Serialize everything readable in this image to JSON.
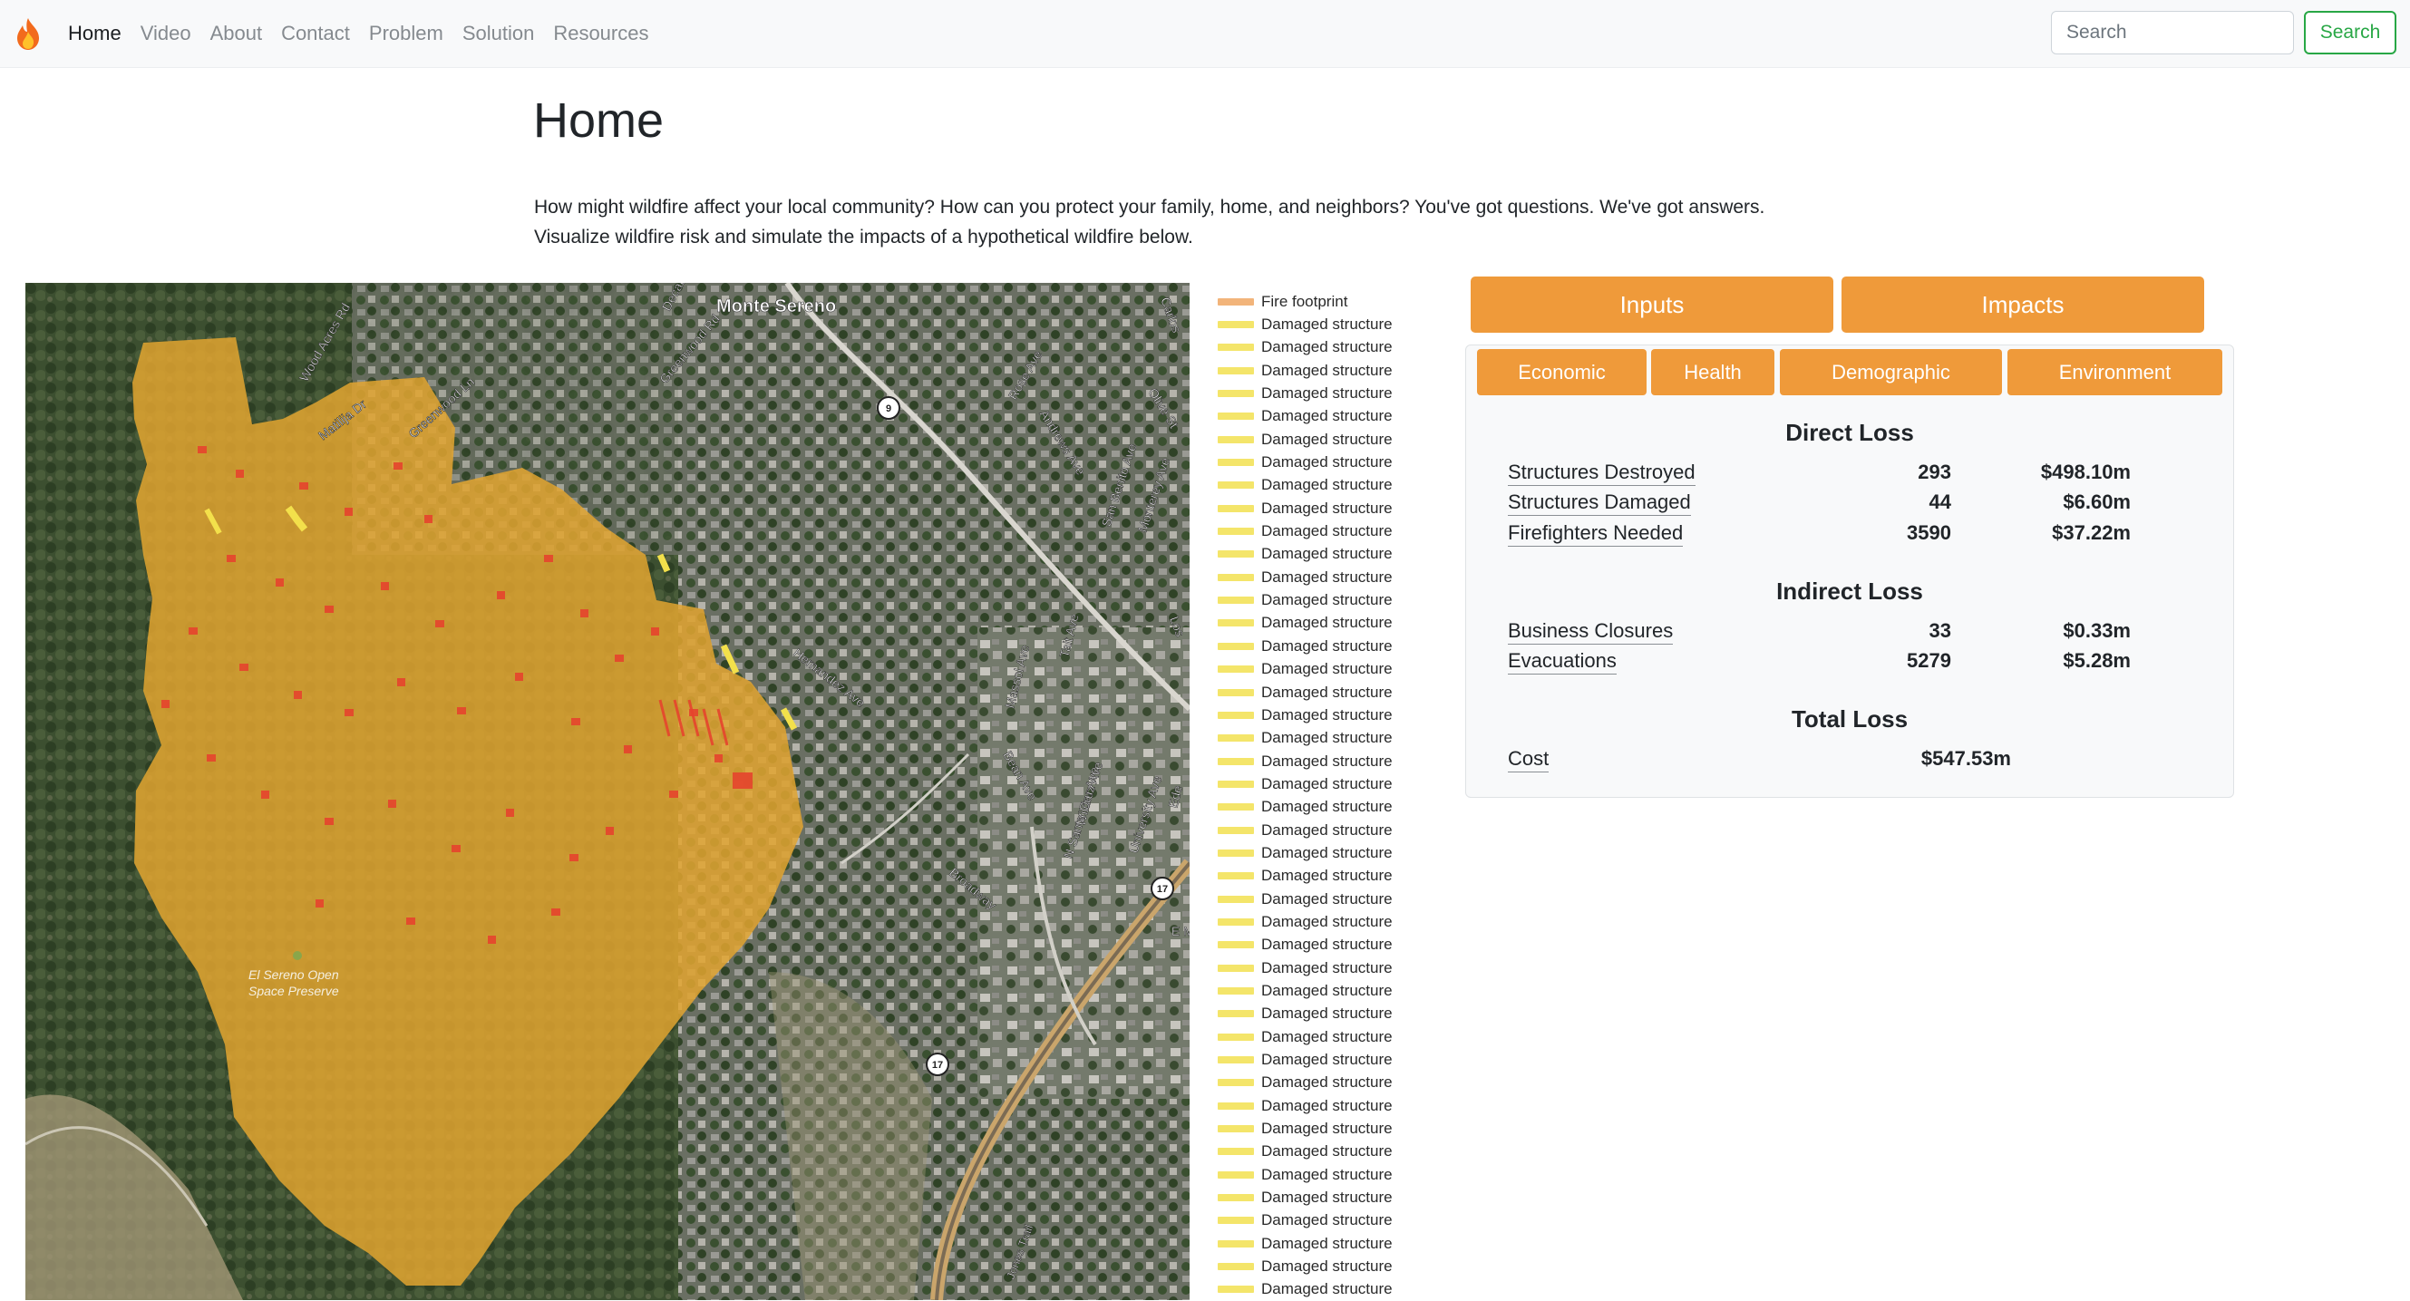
{
  "navbar": {
    "brand_icon": "fire-icon",
    "links": [
      {
        "label": "Home",
        "active": true
      },
      {
        "label": "Video"
      },
      {
        "label": "About"
      },
      {
        "label": "Contact"
      },
      {
        "label": "Problem"
      },
      {
        "label": "Solution"
      },
      {
        "label": "Resources"
      }
    ],
    "search_placeholder": "Search",
    "search_button": "Search"
  },
  "page": {
    "title": "Home",
    "intro_line1": "How might wildfire affect your local community? How can you protect your family, home, and neighbors? You've got questions. We've got answers.",
    "intro_line2": "Visualize wildfire risk and simulate the impacts of a hypothetical wildfire below."
  },
  "map": {
    "labels": {
      "monte_sereno": "Monte Sereno",
      "wood_acres": "Wood Acres Rd",
      "matilija": "Matilija Dr",
      "greenwood_ln": "Greenwood Ln",
      "greenwood_rd": "Greenwood Rd",
      "decatur": "Decat",
      "carlos": "Carlos",
      "rose": "Rose Ave",
      "andrews": "Andrews Ave",
      "olive": "Olive St",
      "san_benito": "San Benito Ave",
      "monterey": "Monterey Ave",
      "hernandez": "Hernandez Ave",
      "massol": "Massol Ave",
      "tait": "Tait Ave",
      "los_gatos": "Los",
      "wilder": "Wilder Ave",
      "bean": "Bean Ave",
      "santa_cruz": "N Santa Cruz Ave",
      "university": "University Ave",
      "broadway": "Broadway",
      "edelen": "Ede",
      "e_main": "E M",
      "preserve": "El Sereno Open\nSpace Preserve",
      "preserve_line1": "El Sereno Open",
      "preserve_line2": "Space Preserve",
      "jones": "Jones Trail",
      "route_9": "9",
      "route_17a": "17",
      "route_17b": "17"
    },
    "colors": {
      "footprint": "#e2a430",
      "damaged": "#e6442d",
      "edge": "#f3e04b"
    }
  },
  "legend": {
    "footprint_label": "Fire footprint",
    "footprint_color": "#f2b47a",
    "damaged_label": "Damaged structure",
    "damaged_color": "#f4e56a",
    "damaged_count": 43
  },
  "panel": {
    "tabs": [
      "Inputs",
      "Impacts"
    ],
    "subtabs": [
      "Economic",
      "Health",
      "Demographic",
      "Environment"
    ],
    "direct": {
      "heading": "Direct Loss",
      "rows": [
        {
          "label": "Structures Destroyed",
          "count": "293",
          "cost": "$498.10m"
        },
        {
          "label": "Structures Damaged",
          "count": "44",
          "cost": "$6.60m"
        },
        {
          "label": "Firefighters Needed",
          "count": "3590",
          "cost": "$37.22m"
        }
      ]
    },
    "indirect": {
      "heading": "Indirect Loss",
      "rows": [
        {
          "label": "Business Closures",
          "count": "33",
          "cost": "$0.33m"
        },
        {
          "label": "Evacuations",
          "count": "5279",
          "cost": "$5.28m"
        }
      ]
    },
    "total": {
      "heading": "Total Loss",
      "label": "Cost",
      "cost": "$547.53m"
    }
  }
}
